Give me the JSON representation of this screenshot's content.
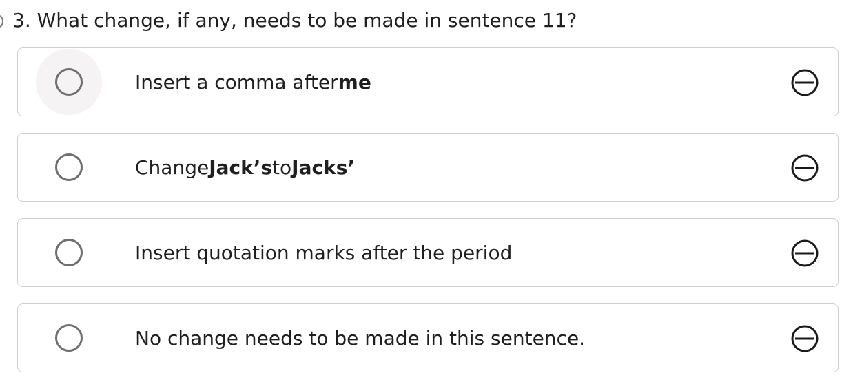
{
  "question": {
    "number": "3.",
    "text": "What change, if any, needs to be made in sentence 11?"
  },
  "options": [
    {
      "parts": [
        "Insert a comma after ",
        "me"
      ]
    },
    {
      "parts": [
        "Change ",
        "Jack’s",
        " to ",
        "Jacks’"
      ]
    },
    {
      "parts": [
        "Insert quotation marks after the period"
      ]
    },
    {
      "parts": [
        "No change needs to be made in this sentence."
      ]
    }
  ],
  "icons": {
    "radio": "radio-button-icon",
    "eliminate": "eliminate-option-icon"
  },
  "colors": {
    "border": "#cfcfcf",
    "radio": "#6f6f6f",
    "hover": "#f5f3f3",
    "text": "#1f1f1f"
  }
}
